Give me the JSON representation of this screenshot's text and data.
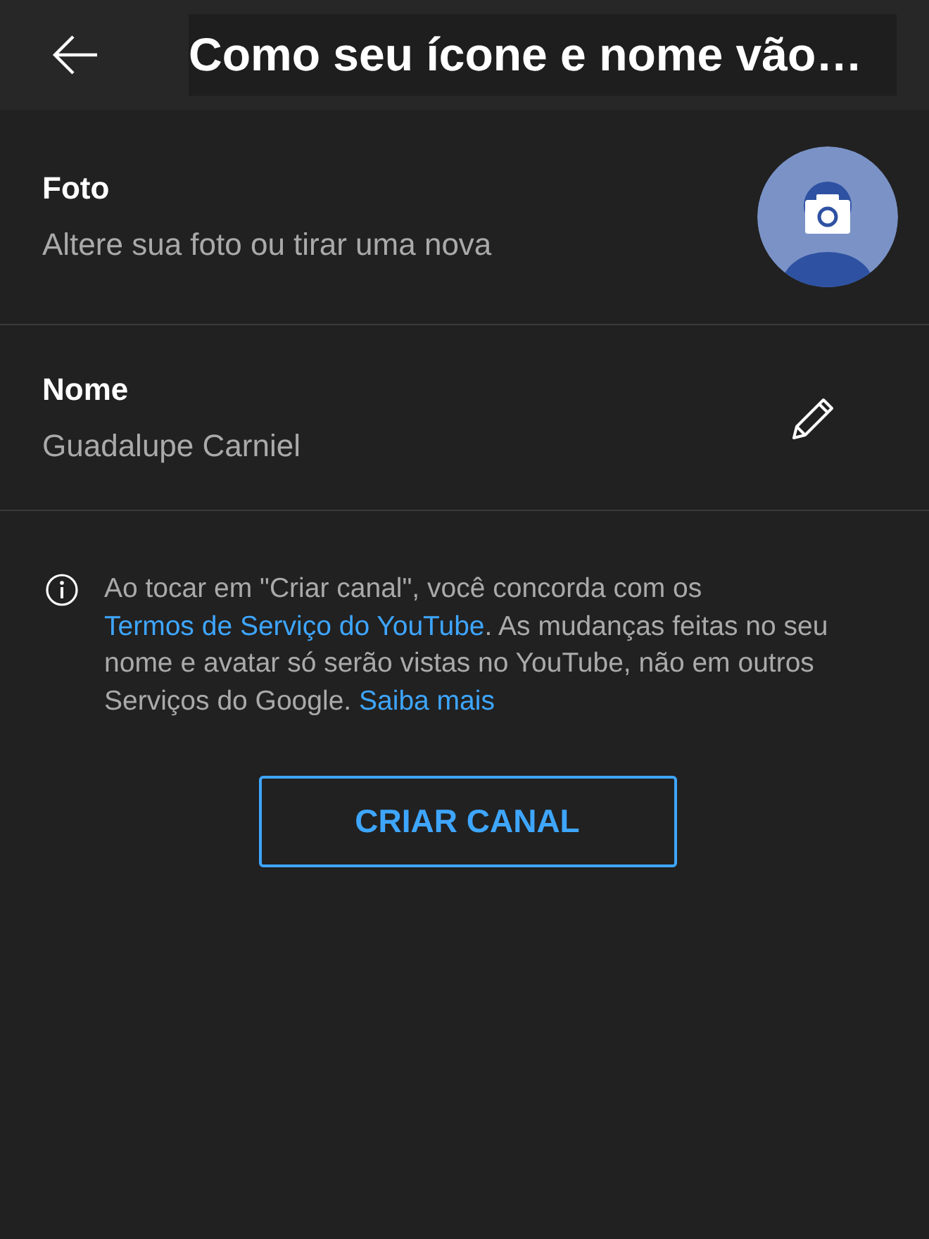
{
  "header": {
    "title": "Como seu ícone e nome vão…"
  },
  "rows": [
    {
      "kind": "photo",
      "label": "Foto",
      "value": "Altere sua foto ou tirar uma nova"
    },
    {
      "kind": "name",
      "label": "Nome",
      "value": "Guadalupe Carniel"
    }
  ],
  "notice": {
    "parts": [
      {
        "kind": "text",
        "text": "Ao tocar em \"Criar canal\", você concorda com os "
      },
      {
        "kind": "link",
        "text": "Termos de Serviço do YouTube"
      },
      {
        "kind": "text",
        "text": ". As mudanças feitas no seu nome e avatar só serão vistas no YouTube, não em outros Serviços do Google. "
      },
      {
        "kind": "link",
        "text": "Saiba mais"
      }
    ]
  },
  "button": {
    "label": "CRIAR CANAL"
  }
}
